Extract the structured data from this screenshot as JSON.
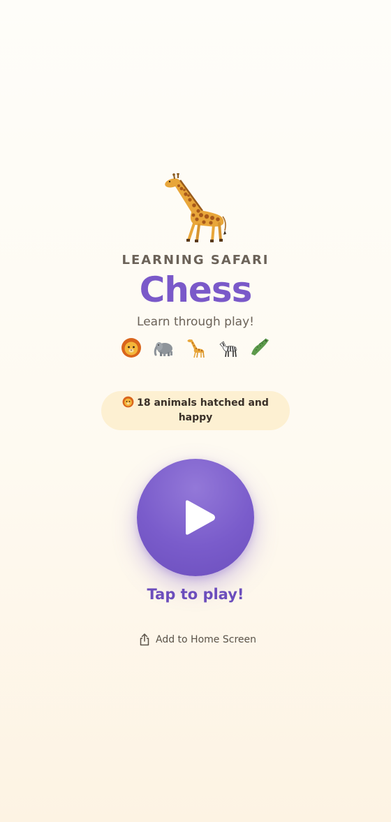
{
  "header": {
    "brand": "LEARNING SAFARI",
    "title": "Chess",
    "tagline": "Learn through play!"
  },
  "hero": {
    "icon": "giraffe-icon"
  },
  "animals": [
    {
      "icon": "lion-icon",
      "glyph": "🦁"
    },
    {
      "icon": "elephant-icon",
      "glyph": "🐘"
    },
    {
      "icon": "giraffe-icon",
      "glyph": "🦒"
    },
    {
      "icon": "zebra-icon",
      "glyph": "🦓"
    },
    {
      "icon": "crocodile-icon",
      "glyph": "🐊"
    }
  ],
  "status": {
    "icon": "lion-icon",
    "text": "18 animals hatched and happy"
  },
  "play": {
    "caption": "Tap to play!",
    "icon": "play-icon"
  },
  "add_home": {
    "label": "Add to Home Screen",
    "icon": "share-icon"
  },
  "colors": {
    "accent": "#7a59c9",
    "pill_bg": "#fdf0d2",
    "background": "#fefaf1"
  }
}
